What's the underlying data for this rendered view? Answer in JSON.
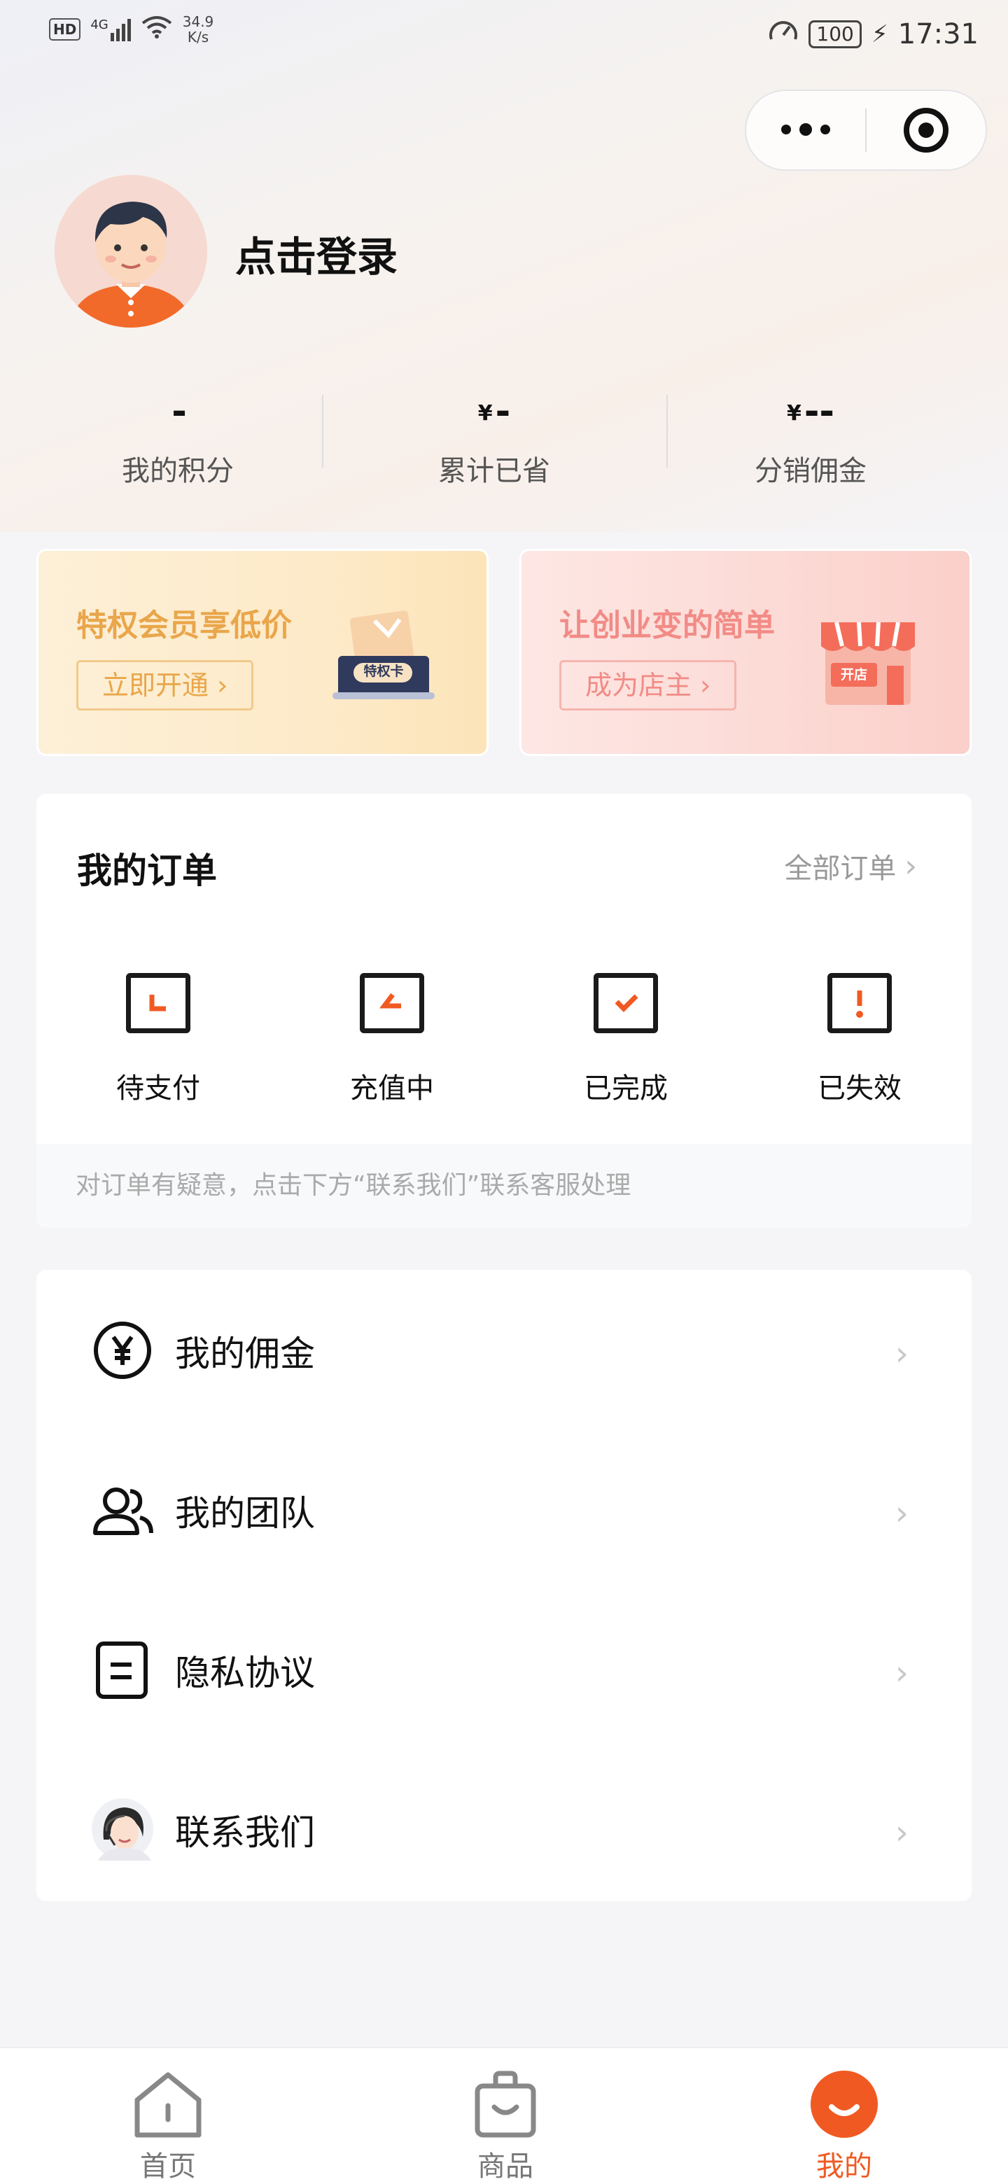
{
  "status_bar": {
    "hd": "HD",
    "network": "4G",
    "speed_value": "34.9",
    "speed_unit": "K/s",
    "battery": "100",
    "time": "17:31"
  },
  "profile": {
    "login_text": "点击登录"
  },
  "stats": [
    {
      "value": "-",
      "currency": "",
      "label": "我的积分"
    },
    {
      "value": "-",
      "currency": "¥",
      "label": "累计已省"
    },
    {
      "value": "--",
      "currency": "¥",
      "label": "分销佣金"
    }
  ],
  "banners": {
    "vip": {
      "title": "特权会员享低价",
      "button": "立即开通 ›",
      "card_text": "特权卡"
    },
    "shop": {
      "title": "让创业变的简单",
      "button": "成为店主 ›",
      "card_text": "开店"
    }
  },
  "orders": {
    "title": "我的订单",
    "all_label": "全部订单",
    "items": [
      {
        "label": "待支付",
        "icon": "pending-payment-icon"
      },
      {
        "label": "充值中",
        "icon": "recharging-icon"
      },
      {
        "label": "已完成",
        "icon": "completed-icon"
      },
      {
        "label": "已失效",
        "icon": "expired-icon"
      }
    ],
    "notice": "对订单有疑意，点击下方“联系我们”联系客服处理"
  },
  "menu": [
    {
      "label": "我的佣金",
      "icon": "yuan-icon"
    },
    {
      "label": "我的团队",
      "icon": "team-icon"
    },
    {
      "label": "隐私协议",
      "icon": "document-icon"
    },
    {
      "label": "联系我们",
      "icon": "customer-service-avatar-icon"
    }
  ],
  "tabbar": [
    {
      "label": "首页",
      "icon": "home-icon",
      "active": false
    },
    {
      "label": "商品",
      "icon": "shopping-bag-icon",
      "active": false
    },
    {
      "label": "我的",
      "icon": "profile-smile-icon",
      "active": true
    }
  ],
  "colors": {
    "accent": "#f05a22",
    "vip_gold": "#e9a64a",
    "shop_pink": "#f28b86"
  }
}
